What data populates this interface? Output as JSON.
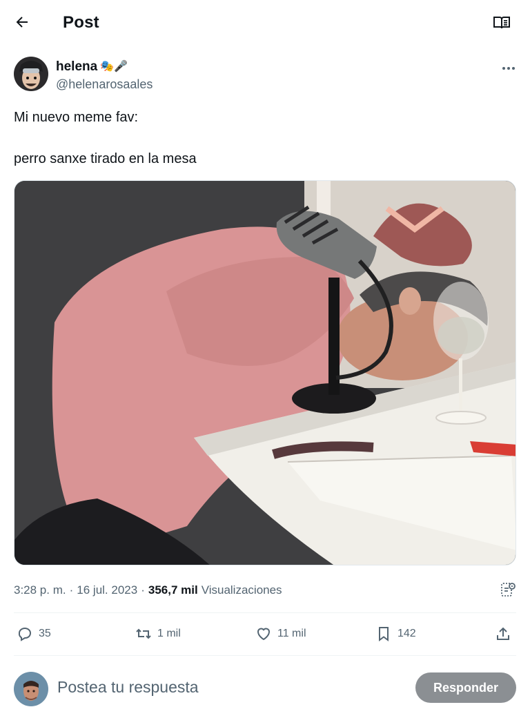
{
  "header": {
    "back_icon": "arrow-left-icon",
    "title": "Post",
    "reader_icon": "open-book-icon"
  },
  "author": {
    "name": "helena",
    "emojis": "🎭🎤",
    "handle": "@helenarosaales",
    "more_icon": "more-horizontal-icon"
  },
  "post": {
    "lines": [
      "Mi nuevo meme fav:",
      "perro sanxe tirado en la mesa"
    ],
    "media_description_icon": "photo"
  },
  "meta": {
    "time": "3:28 p. m.",
    "separator": "·",
    "date": "16 jul. 2023",
    "views_count": "356,7 mil",
    "views_label": "Visualizaciones",
    "analytics_icon": "analytics-icon"
  },
  "actions": {
    "replies": "35",
    "reposts": "1 mil",
    "likes": "11 mil",
    "bookmarks": "142",
    "reply_icon": "reply-icon",
    "repost_icon": "repost-icon",
    "like_icon": "heart-icon",
    "bookmark_icon": "bookmark-icon",
    "share_icon": "share-icon"
  },
  "composer": {
    "placeholder": "Postea tu respuesta",
    "button_label": "Responder"
  },
  "colors": {
    "text_primary": "#0f1419",
    "text_secondary": "#536471",
    "divider": "#eff3f4",
    "reply_button_bg": "#8b8f93"
  }
}
